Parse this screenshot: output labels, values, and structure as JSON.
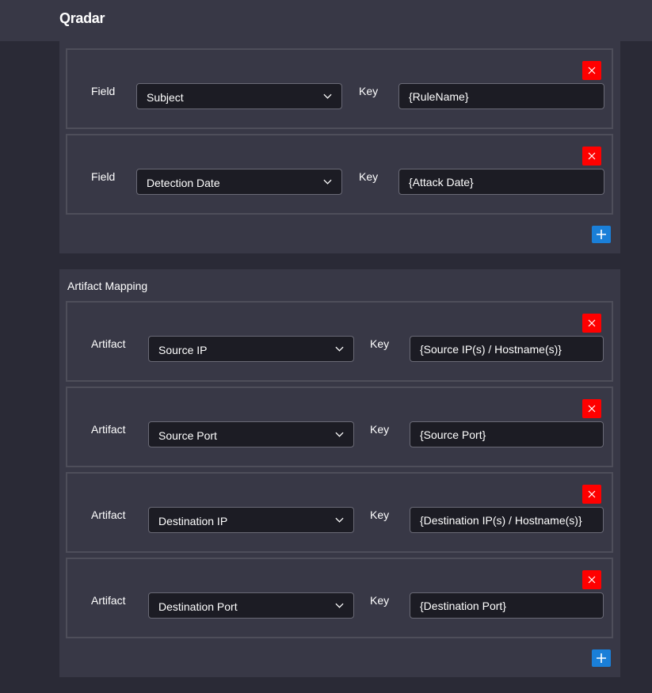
{
  "app": {
    "title": "Qradar"
  },
  "field_mapping": {
    "rows": [
      {
        "label": "Field",
        "selected": "Subject",
        "key_label": "Key",
        "key_value": "{RuleName}",
        "remove_label": "X"
      },
      {
        "label": "Field",
        "selected": "Detection Date",
        "key_label": "Key",
        "key_value": "{Attack Date}",
        "remove_label": "X"
      }
    ]
  },
  "artifact_mapping": {
    "title": "Artifact Mapping",
    "rows": [
      {
        "label": "Artifact",
        "selected": "Source IP",
        "key_label": "Key",
        "key_value": "{Source IP(s) / Hostname(s)}",
        "remove_label": "X"
      },
      {
        "label": "Artifact",
        "selected": "Source Port",
        "key_label": "Key",
        "key_value": "{Source Port}",
        "remove_label": "X"
      },
      {
        "label": "Artifact",
        "selected": "Destination IP",
        "key_label": "Key",
        "key_value": "{Destination IP(s) / Hostname(s)}",
        "remove_label": "X"
      },
      {
        "label": "Artifact",
        "selected": "Destination Port",
        "key_label": "Key",
        "key_value": "{Destination Port}",
        "remove_label": "X"
      }
    ]
  },
  "colors": {
    "background": "#2a2a36",
    "panel": "#383846",
    "input_bg": "#1c1c24",
    "remove": "#ff0000",
    "add": "#1a7fd8"
  }
}
